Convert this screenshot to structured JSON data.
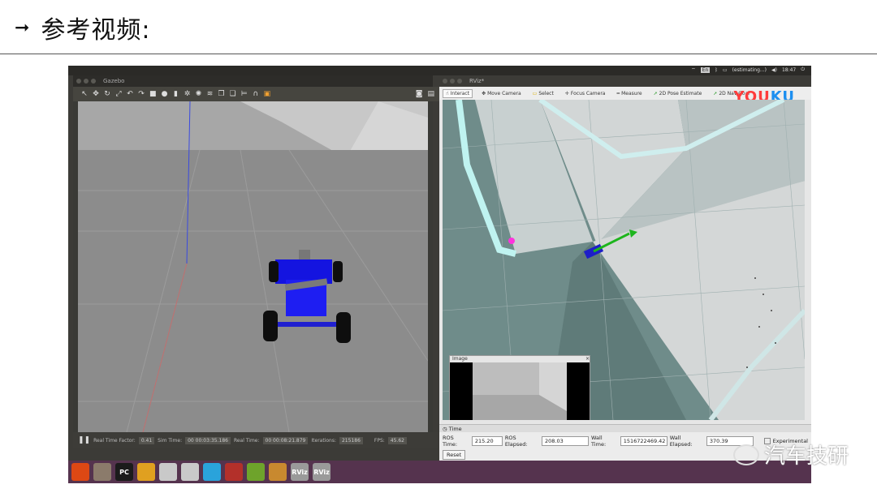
{
  "slide": {
    "title": "参考视频:"
  },
  "topbar": {
    "keyboard": "En",
    "battery": "(estimating...)",
    "clock": "18:47"
  },
  "gazebo": {
    "title": "Gazebo",
    "status": {
      "pause_icon": "pause-icon",
      "real_time_factor_label": "Real Time Factor:",
      "real_time_factor": "0.41",
      "sim_time_label": "Sim Time:",
      "sim_time": "00 00:03:35.186",
      "real_time_label": "Real Time:",
      "real_time": "00 00:08:21.879",
      "iterations_label": "Iterations:",
      "iterations": "215186",
      "fps_label": "FPS:",
      "fps": "45.62"
    }
  },
  "rviz": {
    "title": "RViz*",
    "tools": [
      {
        "label": "Interact",
        "icon": "interact-icon"
      },
      {
        "label": "Move Camera",
        "icon": "move-camera-icon"
      },
      {
        "label": "Select",
        "icon": "select-icon"
      },
      {
        "label": "Focus Camera",
        "icon": "focus-camera-icon"
      },
      {
        "label": "Measure",
        "icon": "measure-icon"
      },
      {
        "label": "2D Pose Estimate",
        "icon": "pose-estimate-icon"
      },
      {
        "label": "2D Nav Goal",
        "icon": "nav-goal-icon"
      }
    ],
    "watermark": {
      "part1": "YOU",
      "part2": "KU"
    },
    "image_panel": {
      "title": "Image"
    },
    "time_panel": {
      "title": "Time",
      "ros_time_label": "ROS Time:",
      "ros_time": "215.20",
      "ros_elapsed_label": "ROS Elapsed:",
      "ros_elapsed": "208.03",
      "wall_time_label": "Wall Time:",
      "wall_time": "1516722469.42",
      "wall_elapsed_label": "Wall Elapsed:",
      "wall_elapsed": "370.39",
      "experimental_label": "Experimental",
      "reset_label": "Reset"
    }
  },
  "dock": [
    {
      "name": "ubuntu-icon",
      "label": "",
      "color": "#dd4814"
    },
    {
      "name": "files-icon",
      "label": "",
      "color": "#8b7b6b"
    },
    {
      "name": "pycharm-icon",
      "label": "PC",
      "color": "#1b1b1b"
    },
    {
      "name": "chrome-icon",
      "label": "",
      "color": "#e0a020"
    },
    {
      "name": "drive-icon",
      "label": "",
      "color": "#c9c9c9"
    },
    {
      "name": "drive-icon",
      "label": "",
      "color": "#c9c9c9"
    },
    {
      "name": "telegram-icon",
      "label": "",
      "color": "#2aa3db"
    },
    {
      "name": "screen-recorder-icon",
      "label": "",
      "color": "#b3302a"
    },
    {
      "name": "nvidia-icon",
      "label": "",
      "color": "#6ea32b"
    },
    {
      "name": "package-icon",
      "label": "",
      "color": "#c8892f"
    },
    {
      "name": "rviz-icon",
      "label": "RViz",
      "color": "#9a9a9a"
    },
    {
      "name": "rviz-icon",
      "label": "RViz",
      "color": "#9a9a9a"
    }
  ],
  "watermark_brand": "汽车技研"
}
